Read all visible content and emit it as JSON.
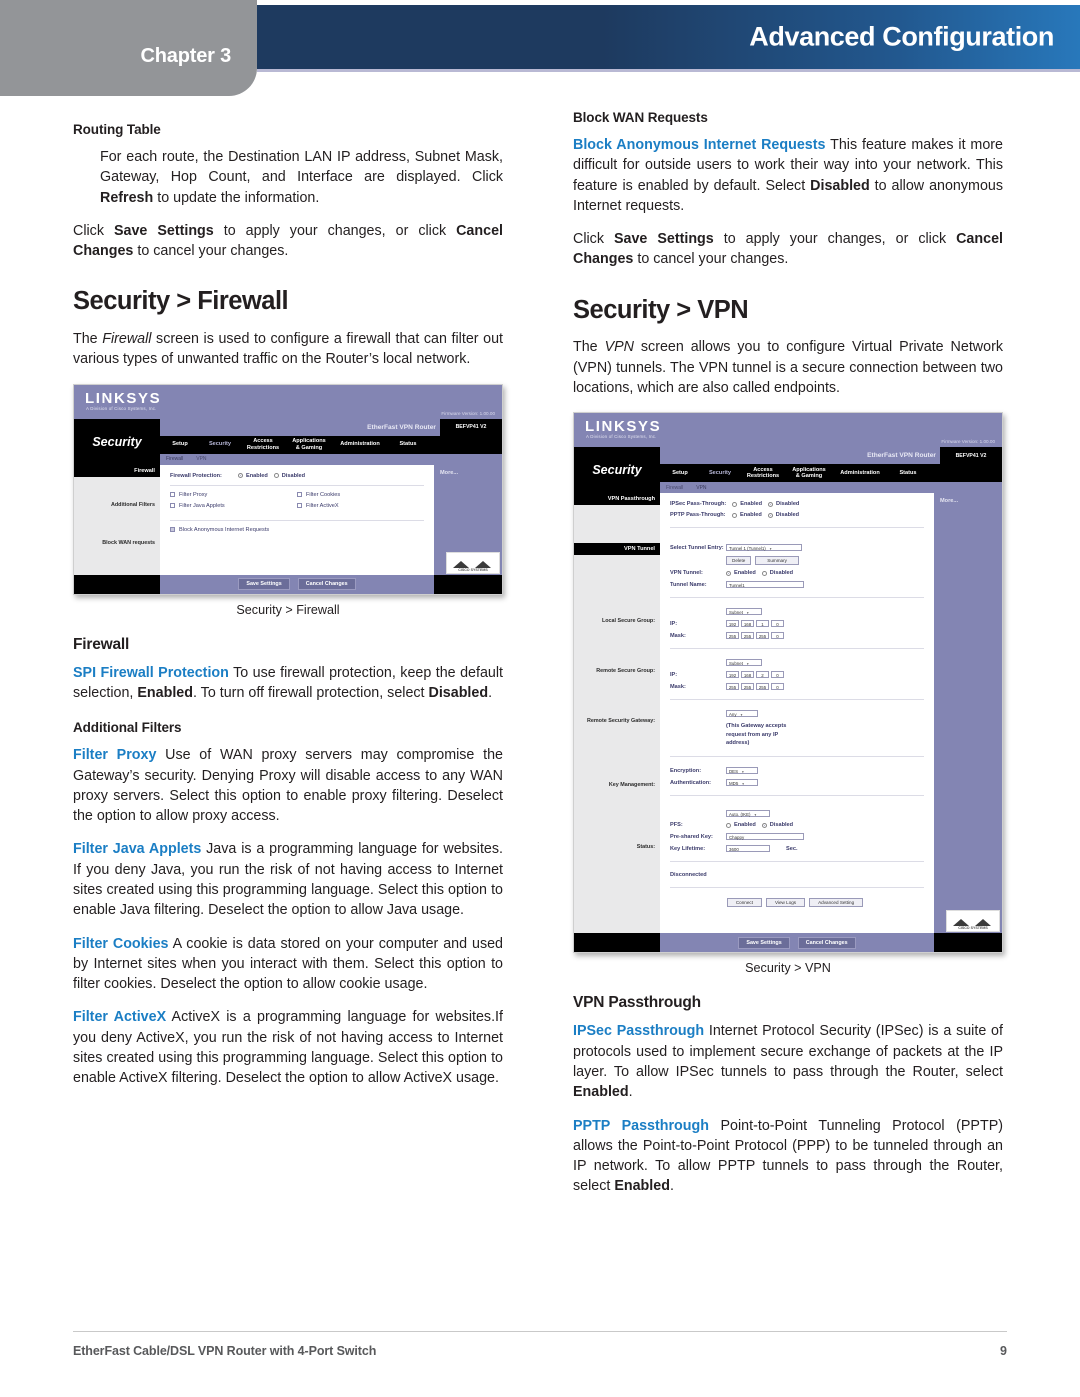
{
  "header": {
    "chapter_label": "Chapter 3",
    "title": "Advanced Configuration",
    "colors": {
      "band_dark": "#1e3a5f",
      "band_light": "#2878bb",
      "tab_gray": "#939598",
      "accent_blue": "#1b7ec4"
    }
  },
  "left_column": {
    "routing_table_heading": "Routing Table",
    "routing_table_p1_a": "For each route, the Destination LAN IP address, Subnet Mask, Gateway, Hop Count, and Interface are displayed. Click ",
    "routing_table_p1_b": "Refresh",
    "routing_table_p1_c": " to update the information.",
    "save_p_a": "Click ",
    "save_p_b": "Save Settings",
    "save_p_c": " to apply your changes, or click ",
    "save_p_d": "Cancel Changes",
    "save_p_e": " to cancel your changes.",
    "security_firewall_heading": "Security > Firewall",
    "firewall_intro_a": "The ",
    "firewall_intro_b": "Firewall",
    "firewall_intro_c": " screen is used to configure a firewall that can filter out various types of unwanted traffic on the Router’s local network.",
    "figure_caption": "Security > Firewall",
    "firewall_heading": "Firewall",
    "spi_term": "SPI Firewall Protection",
    "spi_text_a": " To use firewall protection, keep the default selection, ",
    "spi_text_b": "Enabled",
    "spi_text_c": ". To turn off firewall protection, select ",
    "spi_text_d": "Disabled",
    "spi_text_e": ".",
    "additional_filters_heading": "Additional Filters",
    "filter_proxy_term": "Filter Proxy",
    "filter_proxy_text": "  Use of WAN proxy servers may compromise the Gateway’s security. Denying Proxy will disable access to any WAN proxy servers. Select this option to enable proxy filtering. Deselect the option to allow proxy access.",
    "filter_java_term": "Filter Java Applets",
    "filter_java_text": "  Java is a programming language for websites. If you deny Java, you run the risk of not having access to Internet sites created using this programming language. Select this option to enable Java filtering. Deselect the option to allow Java usage.",
    "filter_cookies_term": "Filter Cookies",
    "filter_cookies_text": "  A cookie is data stored on your computer and used by Internet sites when you interact with them. Select this option to filter cookies. Deselect the option to allow cookie usage.",
    "filter_activex_term": "Filter ActiveX",
    "filter_activex_text": "  ActiveX is a programming language for websites.If you deny ActiveX, you run the risk of not having access to Internet sites created using this programming language. Select this option to enable ActiveX filtering. Deselect the option to allow ActiveX usage."
  },
  "right_column": {
    "block_wan_heading": "Block WAN Requests",
    "block_anon_term": "Block Anonymous Internet Requests",
    "block_anon_text_a": " This feature makes it more difficult for outside users to work their way into your network. This feature is enabled by default. Select ",
    "block_anon_text_b": "Disabled",
    "block_anon_text_c": " to allow anonymous Internet requests.",
    "save_p_a": "Click ",
    "save_p_b": "Save Settings",
    "save_p_c": " to apply your changes, or click ",
    "save_p_d": "Cancel Changes",
    "save_p_e": " to cancel your changes.",
    "security_vpn_heading": "Security > VPN",
    "vpn_intro_a": "The ",
    "vpn_intro_b": "VPN",
    "vpn_intro_c": " screen allows you to configure Virtual Private Network (VPN) tunnels. The VPN tunnel is a secure connection between two locations, which are also called endpoints.",
    "figure_caption": "Security > VPN",
    "vpn_passthrough_heading": "VPN Passthrough",
    "ipsec_term": "IPSec Passthrough",
    "ipsec_text_a": "  Internet Protocol Security (IPSec) is a suite of protocols used to implement secure exchange of packets at the IP layer. To allow IPSec tunnels to pass through the Router, select ",
    "ipsec_text_b": "Enabled",
    "ipsec_text_c": ".",
    "pptp_term": "PPTP Passthrough",
    "pptp_text_a": " Point-to-Point Tunneling Protocol (PPTP) allows the Point-to-Point Protocol (PPP) to be tunneled through an IP network. To allow PPTP tunnels to pass through the Router, select ",
    "pptp_text_b": "Enabled",
    "pptp_text_c": "."
  },
  "firewall_screenshot": {
    "brand": "LINKSYS",
    "brand_sub": "A Division of Cisco Systems, Inc.",
    "firmware": "Firmware Version: 1.00.00",
    "section_title": "Security",
    "device_name": "EtherFast VPN Router",
    "model": "BEFVP41 V2",
    "tabs": [
      "Setup",
      "Security",
      "Access Restrictions",
      "Applications & Gaming",
      "Administration",
      "Status"
    ],
    "active_tab": "Security",
    "subtabs": [
      "Firewall",
      "VPN"
    ],
    "active_subtab": "Firewall",
    "side_labels": [
      "Firewall",
      "Additional Filters",
      "Block WAN requests"
    ],
    "firewall_protection_label": "Firewall Protection:",
    "enabled_label": "Enabled",
    "disabled_label": "Disabled",
    "filters": [
      "Filter Proxy",
      "Filter Cookies",
      "Filter Java Applets",
      "Filter ActiveX"
    ],
    "block_anon_label": "Block Anonymous Internet Requests",
    "more_label": "More...",
    "save_button": "Save Settings",
    "cancel_button": "Cancel Changes",
    "cisco_label": "CISCO SYSTEMS"
  },
  "vpn_screenshot": {
    "brand": "LINKSYS",
    "brand_sub": "A Division of Cisco Systems, Inc.",
    "firmware": "Firmware Version: 1.00.00",
    "section_title": "Security",
    "device_name": "EtherFast VPN Router",
    "model": "BEFVP41 V2",
    "tabs": [
      "Setup",
      "Security",
      "Access Restrictions",
      "Applications & Gaming",
      "Administration",
      "Status"
    ],
    "active_tab": "Security",
    "subtabs": [
      "Firewall",
      "VPN"
    ],
    "active_subtab": "VPN",
    "side_labels": [
      "VPN Passthrough",
      "VPN Tunnel",
      "Local Secure Group:",
      "Remote Secure Group:",
      "Remote Security Gateway:",
      "Key Management:",
      "Status:"
    ],
    "ipsec_pass_label": "IPSec Pass-Through:",
    "pptp_pass_label": "PPTP Pass-Through:",
    "enabled_label": "Enabled",
    "disabled_label": "Disabled",
    "select_tunnel_label": "Select Tunnel Entry:",
    "select_tunnel_value": "Tunnel 1  (Tunnel1)",
    "delete_button": "Delete",
    "summary_button": "Summary",
    "vpn_tunnel_label": "VPN Tunnel:",
    "tunnel_name_label": "Tunnel Name:",
    "tunnel_name_value": "Tunnel1",
    "local_type": "Subnet",
    "local_ip_label": "IP:",
    "local_ip": [
      "192",
      "168",
      "1",
      "0"
    ],
    "local_mask_label": "Mask:",
    "local_mask": [
      "255",
      "255",
      "255",
      "0"
    ],
    "remote_type": "Subnet",
    "remote_ip_label": "IP:",
    "remote_ip": [
      "192",
      "168",
      "2",
      "0"
    ],
    "remote_mask_label": "Mask:",
    "remote_mask": [
      "255",
      "255",
      "255",
      "0"
    ],
    "gateway_type": "Any",
    "gateway_note": "(This Gateway accepts request from any IP address)",
    "encryption_label": "Encryption:",
    "encryption_value": "DES",
    "authentication_label": "Authentication:",
    "authentication_value": "MD5",
    "key_mgmt_value": "Auto. (IKE)",
    "pfs_label": "PFS:",
    "preshared_label": "Pre-shared Key:",
    "preshared_value": "Chappy",
    "key_lifetime_label": "Key Lifetime:",
    "key_lifetime_value": "3600",
    "key_lifetime_unit": "Sec.",
    "status_label": "Status:",
    "status_value": "Disconnected",
    "connect_button": "Connect",
    "viewlogs_button": "View Logs",
    "advanced_button": "Advanced Setting",
    "more_label": "More...",
    "save_button": "Save Settings",
    "cancel_button": "Cancel Changes",
    "cisco_label": "CISCO SYSTEMS"
  },
  "footer": {
    "product": "EtherFast Cable/DSL VPN Router with 4-Port Switch",
    "page_number": "9"
  }
}
